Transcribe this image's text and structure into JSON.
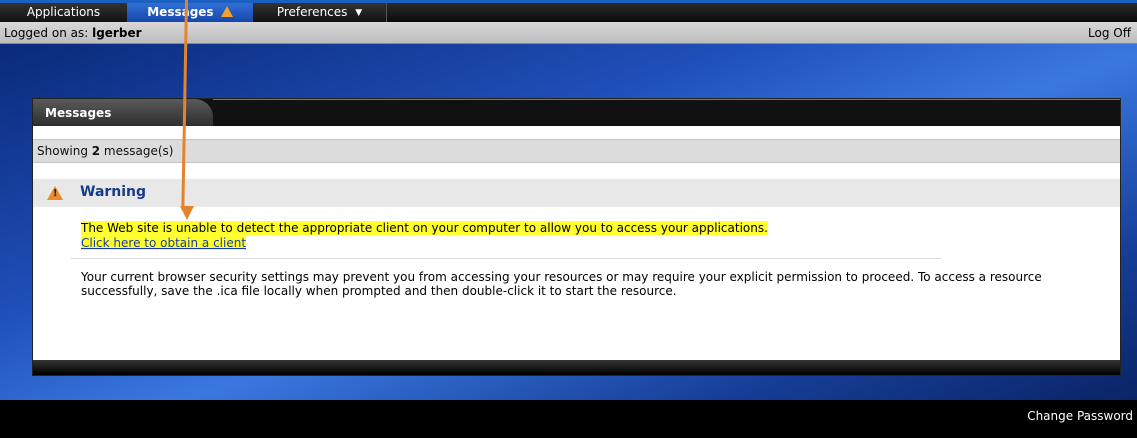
{
  "nav": {
    "tabs": [
      {
        "label": "Applications",
        "icon": "",
        "active": false
      },
      {
        "label": "Messages",
        "icon": "warning-icon",
        "active": true
      },
      {
        "label": "Preferences",
        "icon": "chevron-down-icon",
        "active": false
      }
    ]
  },
  "session": {
    "logged_on_label": "Logged on as: ",
    "username": "lgerber",
    "logoff_label": "Log Off"
  },
  "panel": {
    "title": "Messages",
    "showing_prefix": "Showing ",
    "showing_count": "2",
    "showing_suffix": " message(s)",
    "warning_title": "Warning",
    "message1_text": "The Web site is unable to detect the appropriate client on your computer to allow you to access your applications.",
    "message1_link": "Click here to obtain a client",
    "message2_text": "Your current browser security settings may prevent you from accessing your resources or may require your explicit permission to proceed. To access a resource successfully, save the .ica file locally when prompted and then double-click it to start the resource."
  },
  "footer": {
    "change_password_label": "Change Password"
  },
  "colors": {
    "active_tab": "#1f5ac6",
    "warning_title": "#153b8c",
    "highlight": "#ffff2e",
    "annotation_arrow": "#e5832d"
  }
}
